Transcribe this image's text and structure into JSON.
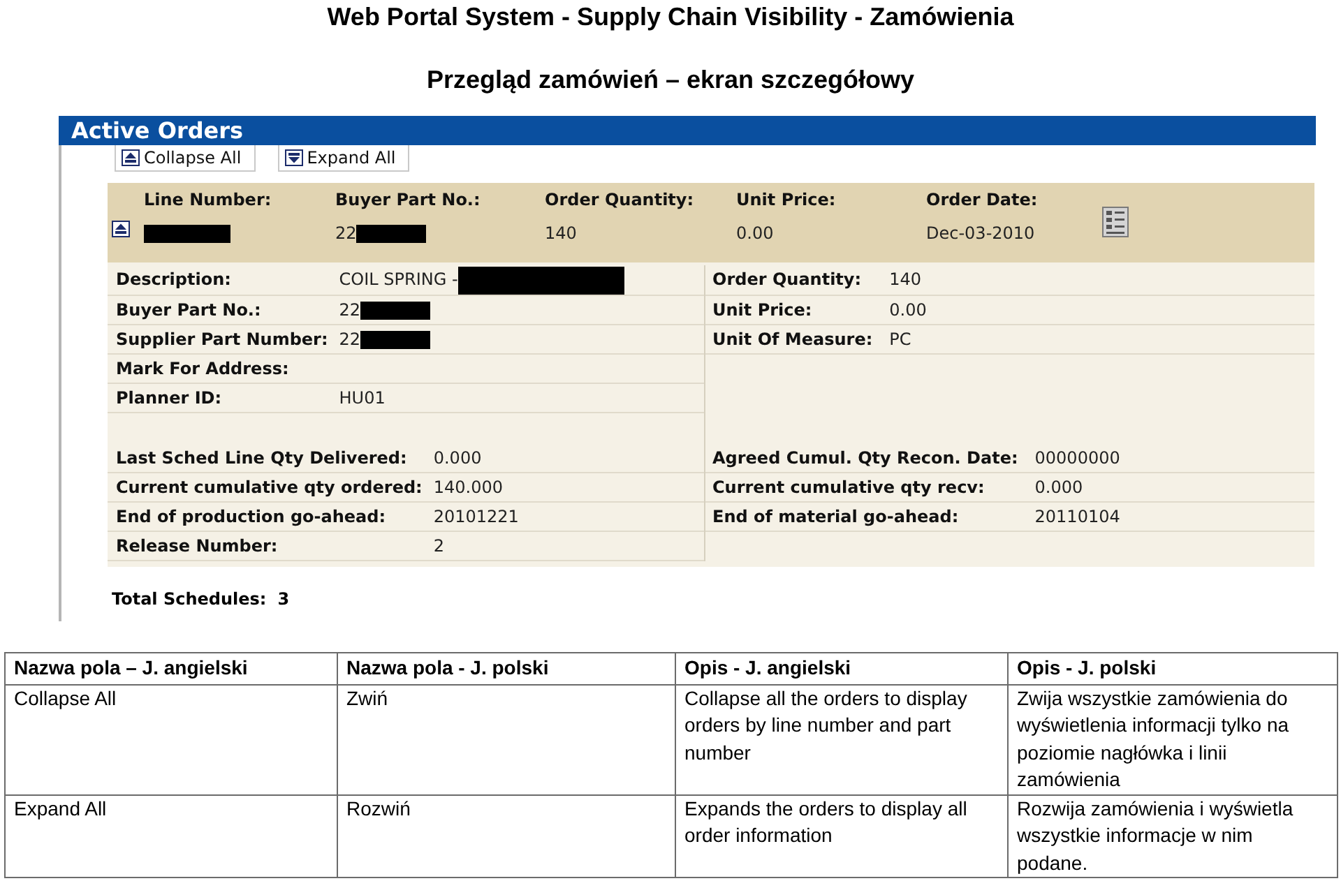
{
  "page_title": "Web Portal System - Supply Chain Visibility - Zamówienia",
  "page_subtitle": "Przegląd zamówień – ekran szczegółowy",
  "app": {
    "title": "Active Orders",
    "toolbar": [
      {
        "kind": "collapse",
        "label": "Collapse All"
      },
      {
        "kind": "expand",
        "label": "Expand All"
      }
    ],
    "order_line": {
      "expanded": true,
      "fields": [
        {
          "label": "Line Number:",
          "redacted": true
        },
        {
          "label": "Buyer Part No.:",
          "value": "22",
          "redacted": true
        },
        {
          "label": "Order Quantity:",
          "value": "140",
          "redacted": false
        },
        {
          "label": "Unit Price:",
          "value": "0.00",
          "redacted": false
        },
        {
          "label": "Order Date:",
          "value": "Dec-03-2010",
          "redacted": false
        }
      ]
    },
    "details": [
      {
        "left": [
          {
            "label": "Description:",
            "value": "COIL SPRING -",
            "redacted": true
          },
          {
            "label": "Buyer Part No.:",
            "value": "22",
            "redacted": true
          },
          {
            "label": "Supplier Part Number:",
            "value": "22",
            "redacted": true
          },
          {
            "label": "Mark For Address:",
            "redacted": false
          },
          {
            "label": "Planner ID:",
            "value": "HU01",
            "redacted": false
          }
        ],
        "right": [
          {
            "label": "Order Quantity:",
            "value": "140"
          },
          {
            "label": "Unit Price:",
            "value": "0.00"
          },
          {
            "label": "Unit Of Measure:",
            "value": "PC"
          }
        ]
      },
      {
        "left": [
          {
            "label": "Last Sched Line Qty Delivered:",
            "value": "0.000"
          },
          {
            "label": "Current cumulative qty ordered:",
            "value": "140.000"
          },
          {
            "label": "End of production go-ahead:",
            "value": "20101221"
          },
          {
            "label": "Release Number:",
            "value": "2"
          }
        ],
        "right": [
          {
            "label": "Agreed Cumul. Qty Recon. Date:",
            "value": "00000000"
          },
          {
            "label": "Current cumulative qty recv:",
            "value": "0.000"
          },
          {
            "label": "End of material go-ahead:",
            "value": "20110104"
          }
        ]
      }
    ],
    "total_schedules": {
      "label": "Total Schedules:",
      "value": "3"
    }
  },
  "legend_table": {
    "columns": [
      "Nazwa pola – J. angielski",
      "Nazwa pola - J. polski",
      "Opis - J. angielski",
      "Opis - J. polski"
    ],
    "rows": [
      [
        "Collapse All",
        "Zwiń",
        "Collapse all the orders to display orders by line number and part number",
        "Zwija wszystkie zamówienia do wyświetlenia informacji tylko na poziomie nagłówka i linii zamówienia"
      ],
      [
        "Expand All",
        "Rozwiń",
        "Expands the orders to display all order information",
        "Rozwija zamówienia i wyświetla wszystkie informacje w nim podane."
      ]
    ]
  }
}
